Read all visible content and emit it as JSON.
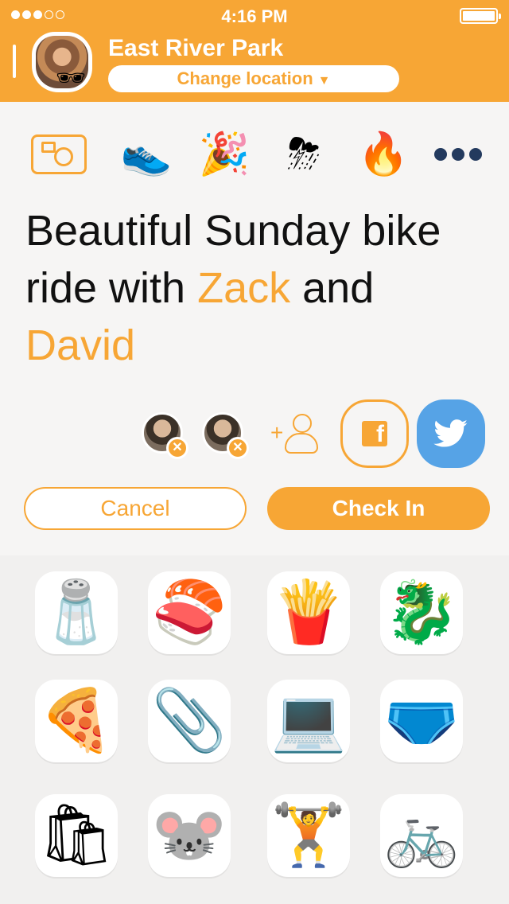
{
  "status_bar": {
    "time": "4:16 PM",
    "signal_bars": 3,
    "signal_total": 5
  },
  "header": {
    "location_name": "East River Park",
    "change_location_label": "Change location",
    "change_location_caret": "▼"
  },
  "categories": [
    {
      "name": "camera-icon",
      "glyph": ""
    },
    {
      "name": "sneaker-icon",
      "glyph": "👟"
    },
    {
      "name": "party-hat-icon",
      "glyph": "🎉"
    },
    {
      "name": "storm-cloud-icon",
      "glyph": "⛈"
    },
    {
      "name": "angry-fire-icon",
      "glyph": "🔥"
    },
    {
      "name": "more-icon",
      "glyph": ""
    }
  ],
  "message": {
    "part1": "Beautiful Sunday bike ride with ",
    "mention1": "Zack",
    "part2": " and ",
    "mention2": "David"
  },
  "share": {
    "remove_glyph": "✕",
    "add_plus": "+",
    "facebook_glyph": "f"
  },
  "actions": {
    "cancel_label": "Cancel",
    "checkin_label": "Check In"
  },
  "stickers": [
    {
      "name": "salt-shaker-sticker",
      "glyph": "🧂"
    },
    {
      "name": "sushi-roll-sticker",
      "glyph": "🍣"
    },
    {
      "name": "fries-sticker",
      "glyph": "🍟"
    },
    {
      "name": "dragon-sticker",
      "glyph": "🐉"
    },
    {
      "name": "pizza-slice-sticker",
      "glyph": "🍕"
    },
    {
      "name": "stapler-sticker",
      "glyph": "📎"
    },
    {
      "name": "laptop-sticker",
      "glyph": "💻"
    },
    {
      "name": "underwear-sticker",
      "glyph": "🩲"
    },
    {
      "name": "shopping-bag-sticker",
      "glyph": "🛍"
    },
    {
      "name": "weightlifting-mouse-sticker",
      "glyph": "🐭"
    },
    {
      "name": "dumbbell-sticker",
      "glyph": "🏋"
    },
    {
      "name": "bicycle-sticker",
      "glyph": "🚲"
    }
  ],
  "colors": {
    "accent": "#f7a635",
    "twitter": "#56a3e6",
    "background": "#f6f5f4"
  }
}
